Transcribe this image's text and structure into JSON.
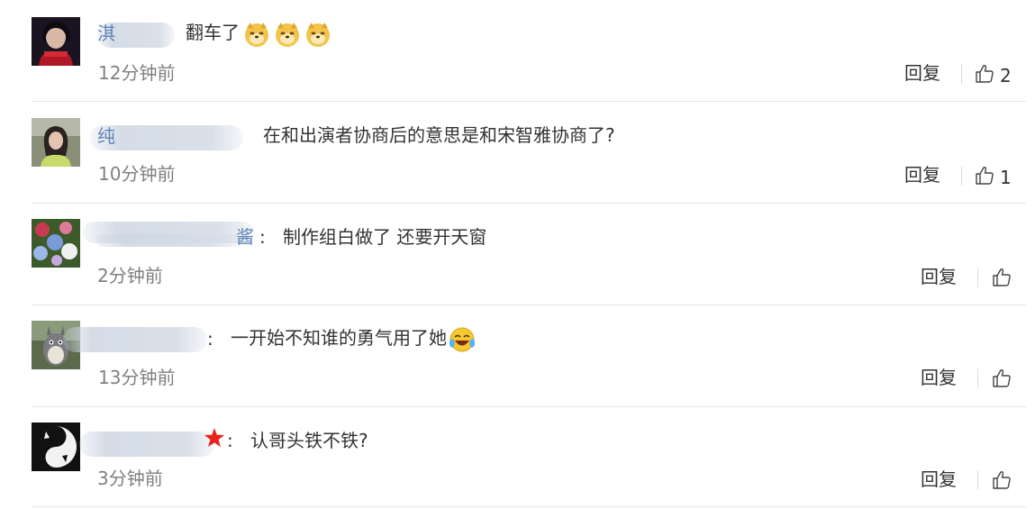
{
  "comments": [
    {
      "username_fragment": "淇",
      "username_suffix": "",
      "separator": "",
      "text": "翻车了",
      "emojis": [
        "doge-emoji",
        "doge-emoji",
        "doge-emoji"
      ],
      "time": "12分钟前",
      "reply_label": "回复",
      "like_count": "2",
      "avatar": "avatar-girl-red-scarf"
    },
    {
      "username_fragment": "纯",
      "username_suffix": "",
      "separator": "",
      "text": "在和出演者协商后的意思是和宋智雅协商了?",
      "emojis": [],
      "time": "10分钟前",
      "reply_label": "回复",
      "like_count": "1",
      "avatar": "avatar-woman-photo"
    },
    {
      "username_fragment": "",
      "username_suffix": "酱",
      "separator": ":",
      "text": "制作组白做了 还要开天窗",
      "emojis": [],
      "time": "2分钟前",
      "reply_label": "回复",
      "like_count": "",
      "avatar": "avatar-flowers"
    },
    {
      "username_fragment": "",
      "username_suffix": "",
      "separator": ":",
      "text": "一开始不知谁的勇气用了她",
      "emojis": [
        "laugh-cry-emoji"
      ],
      "time": "13分钟前",
      "reply_label": "回复",
      "like_count": "",
      "avatar": "avatar-totoro"
    },
    {
      "username_fragment": "",
      "username_suffix": "",
      "separator": ":",
      "text": "认哥头铁不铁?",
      "emojis": [],
      "time": "3分钟前",
      "reply_label": "回复",
      "like_count": "",
      "avatar": "avatar-black-white-cats",
      "badge": "red-star-badge"
    }
  ],
  "colors": {
    "username": "#5d84b8",
    "time": "#808080",
    "divider": "#e6e6e6",
    "badge": "#e8231c"
  }
}
